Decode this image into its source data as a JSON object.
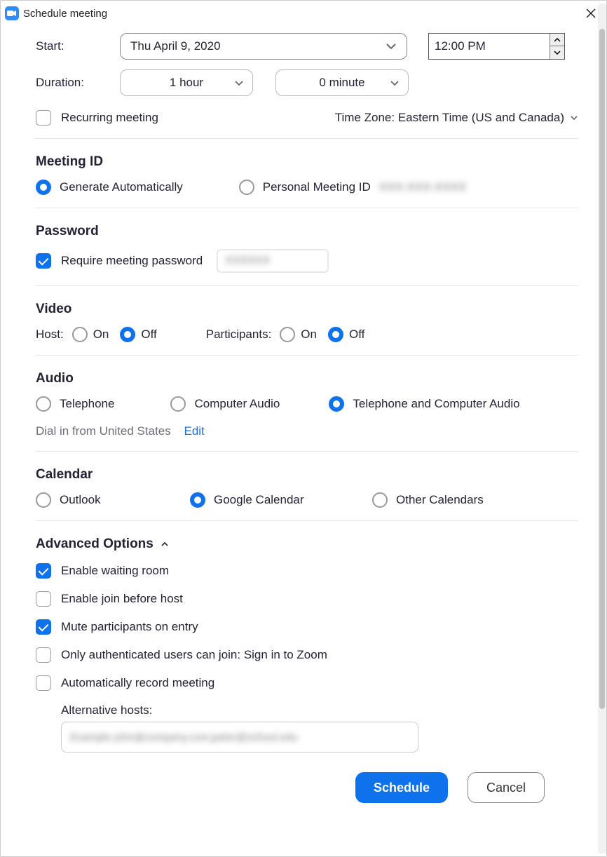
{
  "window": {
    "title": "Schedule meeting"
  },
  "start": {
    "label": "Start:",
    "date": "Thu  April 9, 2020",
    "time": "12:00 PM"
  },
  "duration": {
    "label": "Duration:",
    "hours": "1 hour",
    "minutes": "0 minute"
  },
  "recurring": {
    "label": "Recurring meeting",
    "checked": false
  },
  "timezone": {
    "text": "Time Zone: Eastern Time (US and Canada)"
  },
  "meeting_id": {
    "heading": "Meeting ID",
    "auto_label": "Generate Automatically",
    "personal_label": "Personal Meeting ID",
    "personal_value": "XXX-XXX-XXXX",
    "selected": "auto"
  },
  "password": {
    "heading": "Password",
    "require_label": "Require meeting password",
    "checked": true,
    "value": "XXXXXX"
  },
  "video": {
    "heading": "Video",
    "host_label": "Host:",
    "participants_label": "Participants:",
    "on": "On",
    "off": "Off",
    "host_selected": "off",
    "participants_selected": "off"
  },
  "audio": {
    "heading": "Audio",
    "telephone": "Telephone",
    "computer": "Computer Audio",
    "both": "Telephone and Computer Audio",
    "selected": "both",
    "dial_text": "Dial in from United States",
    "edit": "Edit"
  },
  "calendar": {
    "heading": "Calendar",
    "outlook": "Outlook",
    "google": "Google Calendar",
    "other": "Other Calendars",
    "selected": "google"
  },
  "advanced": {
    "heading": "Advanced Options",
    "waiting_room": {
      "label": "Enable waiting room",
      "checked": true
    },
    "join_before": {
      "label": "Enable join before host",
      "checked": false
    },
    "mute_entry": {
      "label": "Mute participants on entry",
      "checked": true
    },
    "auth_only": {
      "label": "Only authenticated users can join: Sign in to Zoom",
      "checked": false
    },
    "auto_record": {
      "label": "Automatically record meeting",
      "checked": false
    },
    "alt_hosts_label": "Alternative hosts:",
    "alt_hosts_placeholder": "Example john@company.com;peter@school.edu"
  },
  "footer": {
    "schedule": "Schedule",
    "cancel": "Cancel"
  }
}
